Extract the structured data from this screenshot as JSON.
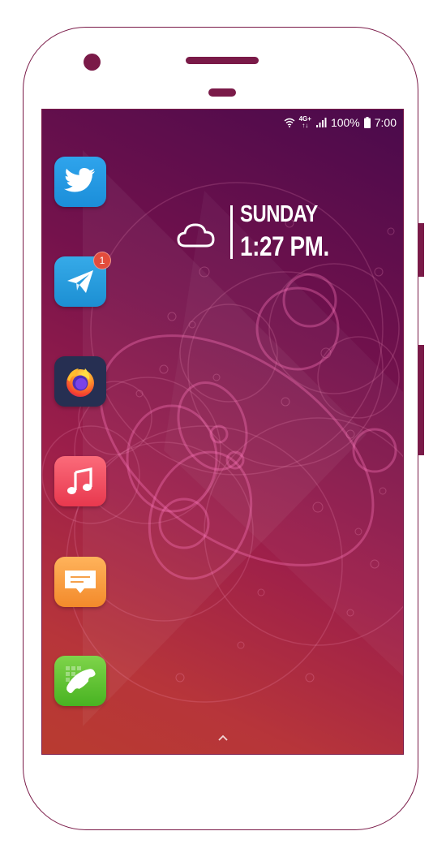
{
  "status_bar": {
    "network_top": "4G+",
    "network_bottom": "↑↓",
    "battery_percent": "100%",
    "time": "7:00"
  },
  "widget": {
    "weather_icon": "cloud-icon",
    "day": "SUNDAY",
    "time": "1:27 PM."
  },
  "apps": [
    {
      "name": "Twitter",
      "icon": "twitter-bird-icon"
    },
    {
      "name": "Telegram",
      "icon": "paper-plane-icon",
      "badge": "1"
    },
    {
      "name": "Firefox",
      "icon": "firefox-icon"
    },
    {
      "name": "Music",
      "icon": "music-note-icon"
    },
    {
      "name": "Messages",
      "icon": "message-bubble-icon"
    },
    {
      "name": "Phone",
      "icon": "phone-handset-icon"
    }
  ],
  "app_drawer": {
    "icon": "chevron-up-icon"
  },
  "colors": {
    "frame": "#7a1a48",
    "wallpaper_top": "#4a0a4c",
    "wallpaper_bottom": "#b83b30"
  }
}
